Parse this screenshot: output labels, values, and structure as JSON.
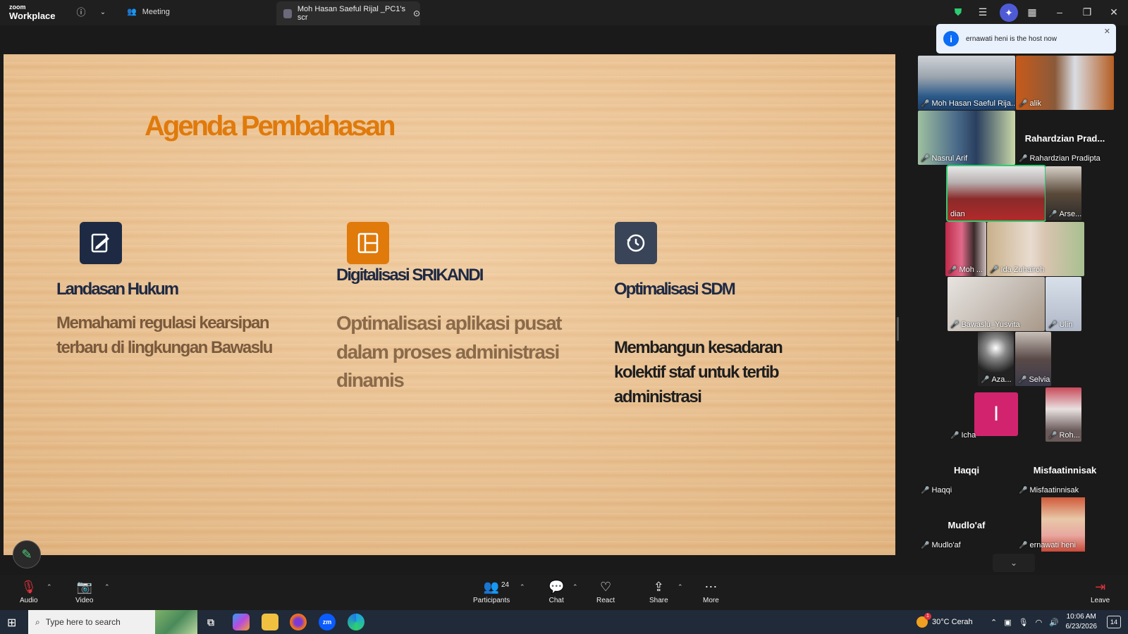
{
  "app": {
    "brand_top": "zoom",
    "brand_bottom": "Workplace"
  },
  "titlebar": {
    "meeting_label": "Meeting",
    "share_tab_label": "Moh Hasan Saeful Rijal _PC1's scr"
  },
  "toast": {
    "text": "ernawati heni is the host now"
  },
  "slide": {
    "title": "Agenda Pembahasan",
    "columns": [
      {
        "heading": "Landasan Hukum",
        "body": "Memahami regulasi kearsipan terbaru di lingkungan Bawaslu",
        "icon": "edit-doc-icon"
      },
      {
        "heading": "Digitalisasi SRIKANDI",
        "body": "Optimalisasi aplikasi pusat dalam proses administrasi dinamis",
        "icon": "hierarchy-icon"
      },
      {
        "heading": "Optimalisasi SDM",
        "body": "Membangun kesadaran kolektif staf untuk tertib administrasi",
        "icon": "history-icon"
      }
    ]
  },
  "gallery": {
    "tiles": [
      {
        "name": "Moh Hasan Saeful Rija..."
      },
      {
        "name": "alik"
      },
      {
        "name": "Nasrul Arif"
      },
      {
        "name": "Rahardzian Pradipta",
        "display": "Rahardzian  Prad..."
      },
      {
        "name": "dian"
      },
      {
        "name": "Arse..."
      },
      {
        "name": "Moh ..."
      },
      {
        "name": "Ida Zuhairoh"
      },
      {
        "name": "Bawaslu_Yusvita"
      },
      {
        "name": "Ulin"
      },
      {
        "name": "Aza..."
      },
      {
        "name": "Selvia"
      },
      {
        "name": "Icha",
        "initial": "I"
      },
      {
        "name": "Roh..."
      },
      {
        "name": "Haqqi",
        "display": "Haqqi"
      },
      {
        "name": "Misfaatinnisak",
        "display": "Misfaatinnisak"
      },
      {
        "name": "Mudlo'af",
        "display": "Mudlo'af"
      },
      {
        "name": "ernawati heni"
      }
    ]
  },
  "toolbar": {
    "audio": "Audio",
    "video": "Video",
    "participants": "Participants",
    "participants_count": "24",
    "chat": "Chat",
    "react": "React",
    "share": "Share",
    "more": "More",
    "leave": "Leave"
  },
  "taskbar": {
    "search_placeholder": "Type here to search",
    "weather": "30°C  Cerah",
    "time": "10:06 AM",
    "date": "6/23/2026",
    "notifications": "14",
    "weather_badge": "1"
  },
  "colors": {
    "accent_orange": "#e07a0b",
    "navy": "#1e2a44",
    "mic_off_red": "#e0323c",
    "active_speaker": "#2ecc71",
    "initial_bg": "#d2246e"
  }
}
